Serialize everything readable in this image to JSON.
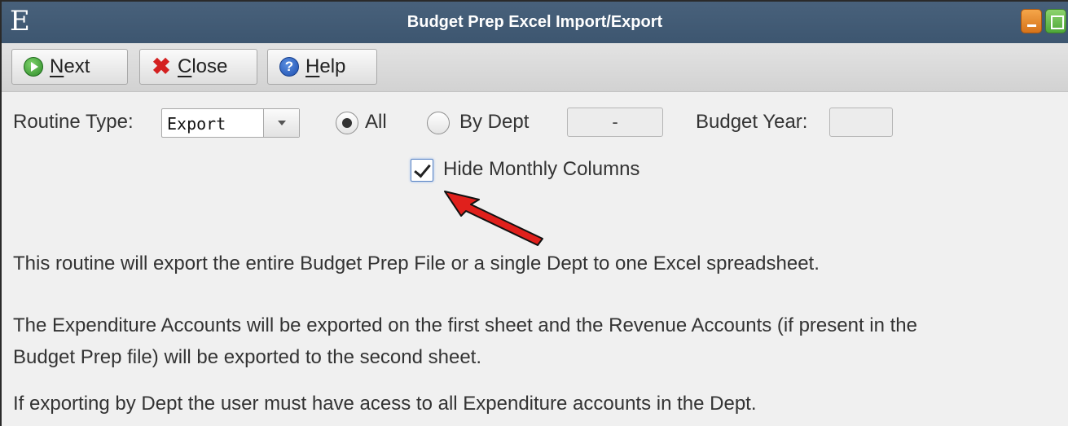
{
  "window": {
    "app_logo": "E",
    "title": "Budget Prep Excel Import/Export"
  },
  "toolbar": {
    "next": {
      "mnemonic": "N",
      "rest": "ext",
      "icon": "next-arrow-icon"
    },
    "close": {
      "mnemonic": "C",
      "rest": "lose",
      "icon": "close-x-icon"
    },
    "help": {
      "mnemonic": "H",
      "rest": "elp",
      "icon": "help-question-icon"
    }
  },
  "form": {
    "routine_type_label": "Routine Type:",
    "routine_type_value": "Export",
    "radio_all_label": "All",
    "radio_by_dept_label": "By Dept",
    "selected_scope": "All",
    "dept_value": "-",
    "budget_year_label": "Budget Year:",
    "budget_year_value": "",
    "hide_monthly_label": "Hide Monthly Columns",
    "hide_monthly_checked": true
  },
  "description": {
    "line1": "This routine will export the entire Budget Prep File or a single Dept to one Excel spreadsheet.",
    "line2a": "The Expenditure Accounts will be exported on the first sheet and the Revenue Accounts (if present in the",
    "line2b": "Budget Prep file) will be exported to the second sheet.",
    "line3": "If exporting by Dept the user must have acess to all Expenditure accounts in the Dept."
  },
  "colors": {
    "titlebar": "#44607a",
    "annotation_arrow": "#e0201c"
  }
}
